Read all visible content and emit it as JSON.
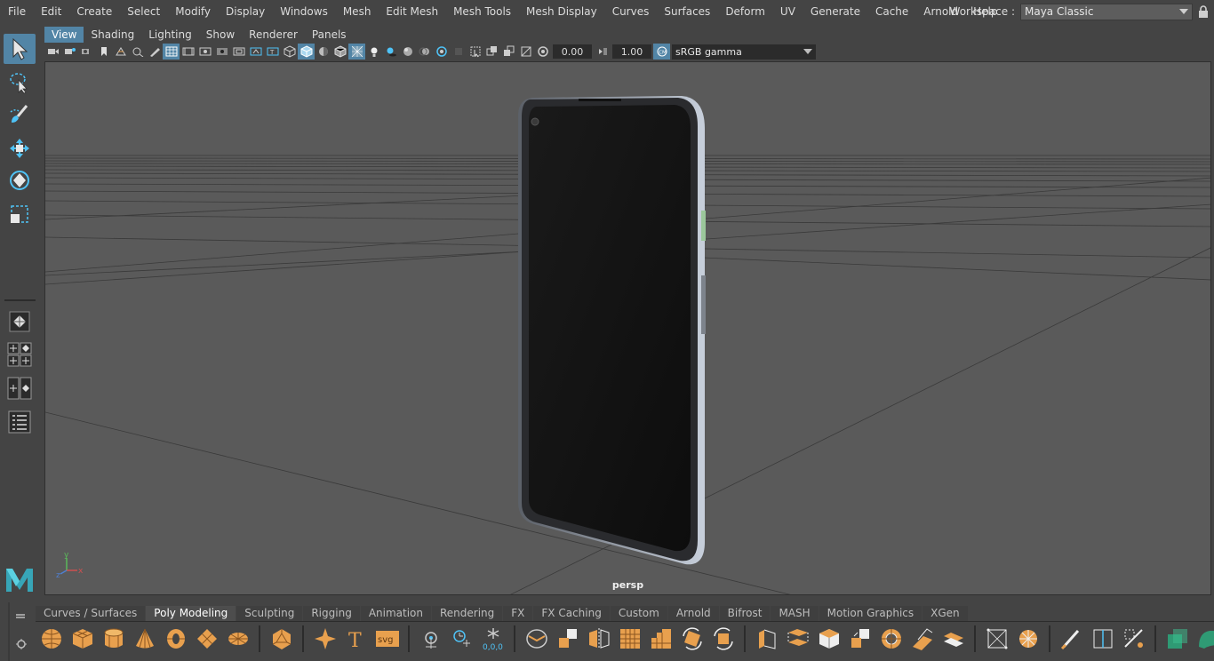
{
  "menubar": {
    "items": [
      "File",
      "Edit",
      "Create",
      "Select",
      "Modify",
      "Display",
      "Windows",
      "Mesh",
      "Edit Mesh",
      "Mesh Tools",
      "Mesh Display",
      "Curves",
      "Surfaces",
      "Deform",
      "UV",
      "Generate",
      "Cache",
      "Arnold",
      "Help"
    ],
    "workspace_label": "Workspace :",
    "workspace_value": "Maya Classic"
  },
  "panel": {
    "menu": [
      "View",
      "Shading",
      "Lighting",
      "Show",
      "Renderer",
      "Panels"
    ],
    "active_menu": "View",
    "exposure": "0.00",
    "gamma": "1.00",
    "colorspace": "sRGB gamma"
  },
  "viewport": {
    "camera_label": "persp",
    "axis_labels": {
      "x": "x",
      "y": "y",
      "z": "z"
    }
  },
  "shelf": {
    "tabs": [
      "Curves / Surfaces",
      "Poly Modeling",
      "Sculpting",
      "Rigging",
      "Animation",
      "Rendering",
      "FX",
      "FX Caching",
      "Custom",
      "Arnold",
      "Bifrost",
      "MASH",
      "Motion Graphics",
      "XGen"
    ],
    "active_tab": "Poly Modeling",
    "text_icon_label": "T",
    "svg_icon_label": "svg",
    "origin_icon_label": "0,0,0"
  },
  "colors": {
    "accent": "#5285a6",
    "viewport_bg": "#5a5a5a",
    "shelf_orange": "#e8a04e",
    "shelf_teal": "#2f9a74"
  }
}
